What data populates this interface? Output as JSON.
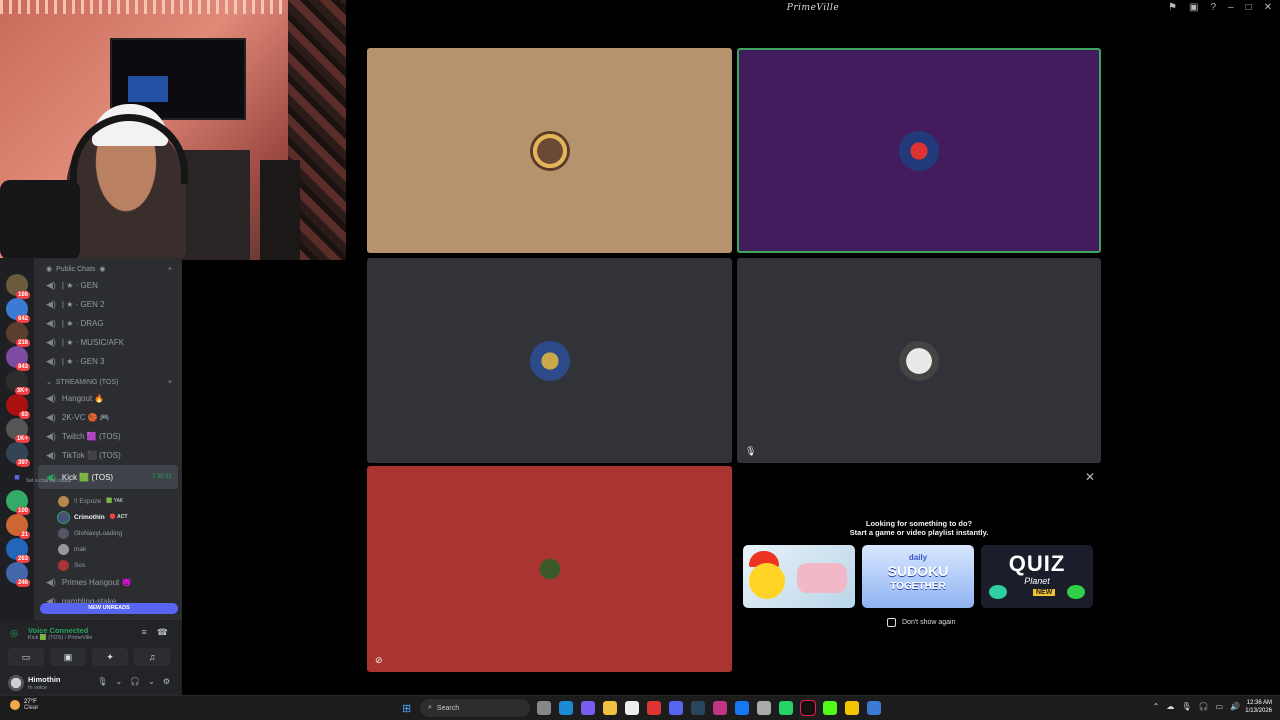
{
  "window": {
    "title": "PrimeVille"
  },
  "titlebar_icons": [
    "flag-icon",
    "inbox-icon",
    "help-icon",
    "minimize-icon",
    "maximize-icon",
    "close-icon"
  ],
  "titlebar_glyphs": [
    "⚑",
    "▣",
    "?",
    "–",
    "□",
    "✕"
  ],
  "servers": [
    {
      "badge": "166"
    },
    {
      "badge": "642"
    },
    {
      "badge": "216"
    },
    {
      "badge": "843"
    },
    {
      "badge": "3K+"
    },
    {
      "badge": "63"
    },
    {
      "badge": "1K+"
    },
    {
      "badge": "397"
    },
    {
      "badge": ""
    },
    {
      "badge": "100"
    },
    {
      "badge": "21"
    },
    {
      "badge": "263"
    },
    {
      "badge": "246"
    }
  ],
  "channels": {
    "public_category": "Public Chats",
    "public": [
      {
        "label": "| ★ · GEN"
      },
      {
        "label": "| ★ · GEN 2"
      },
      {
        "label": "| ★ · DRAG"
      },
      {
        "label": "| ★ · MUSIC/AFK"
      },
      {
        "label": "| ★ · GEN 3"
      }
    ],
    "streaming_category": "STREAMING (TOS)",
    "streaming": [
      {
        "label": "Hangout 🔥"
      },
      {
        "label": "2K-VC 🏀 🎮"
      },
      {
        "label": "Twitch 🟪 (TOS)"
      },
      {
        "label": "TikTok ⬛ (TOS)"
      }
    ],
    "active": {
      "label": "Kick 🟩 (TOS)",
      "timer": "7:30:31",
      "status": "Set a channel status"
    },
    "members": [
      {
        "name": "!! Expoze",
        "tag": "🟩 YAK",
        "bright": false
      },
      {
        "name": "Crimothin",
        "tag": "🔴 ACT",
        "bright": true
      },
      {
        "name": "GloNavyLoading",
        "tag": "",
        "bright": false
      },
      {
        "name": "mak",
        "tag": "",
        "bright": false
      },
      {
        "name": "Sos",
        "tag": "",
        "bright": false
      }
    ],
    "after": [
      {
        "label": "Primes Hangout 😈"
      },
      {
        "label": "gambling-stake"
      }
    ],
    "new_unreads": "NEW UNREADS"
  },
  "voice": {
    "status": "Voice Connected",
    "location": "Kick 🟩 (TOS) / PrimeVille"
  },
  "user": {
    "name": "Himothin",
    "status": "In voice"
  },
  "tiles": [
    {
      "name": "tile-1",
      "color": "#b4936d"
    },
    {
      "name": "tile-2",
      "color": "#431c5e"
    },
    {
      "name": "tile-3",
      "color": "#313338"
    },
    {
      "name": "tile-4",
      "color": "#313338"
    },
    {
      "name": "tile-5",
      "color": "#a93430"
    }
  ],
  "activity": {
    "line1": "Looking for something to do?",
    "line2": "Start a game or video playlist instantly.",
    "cards": [
      {
        "name": "chick-game"
      },
      {
        "name": "daily-sudoku",
        "t1": "daily",
        "t2": "SUDOKU",
        "t3": "TOGETHER"
      },
      {
        "name": "quiz-planet",
        "t1": "QUIZ",
        "t2": "Planet",
        "t3": "NEW"
      }
    ],
    "dont_show": "Don't show again"
  },
  "taskbar": {
    "temp": "27°F",
    "condition": "Clear",
    "search": "Search",
    "time": "12:36 AM",
    "date": "1/13/2026"
  }
}
